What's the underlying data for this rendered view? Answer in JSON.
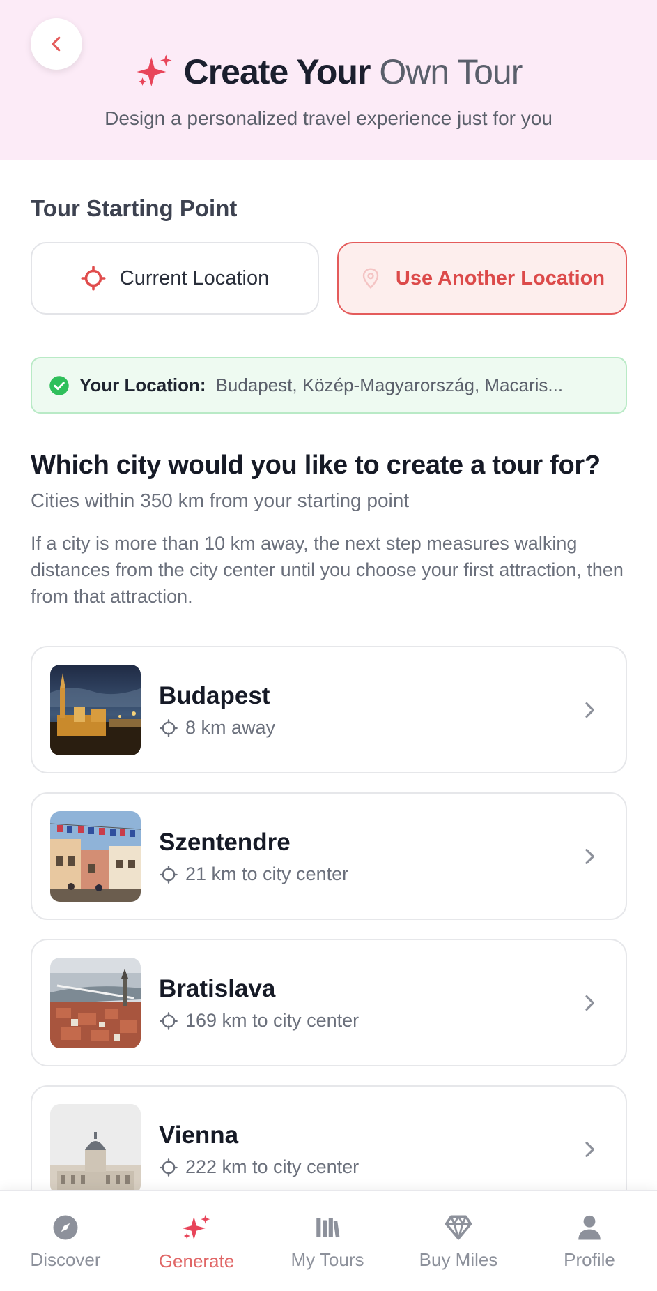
{
  "header": {
    "title_bold": "Create Your",
    "title_light": "Own Tour",
    "subtitle": "Design a personalized travel experience just for you",
    "back_icon": "chevron-left-icon",
    "title_icon": "sparkles-icon"
  },
  "starting_point": {
    "label": "Tour Starting Point",
    "current_label": "Current Location",
    "other_label": "Use Another Location",
    "selected": "other"
  },
  "your_location": {
    "label": "Your Location:",
    "value": "Budapest, Közép-Magyarország, Macaris..."
  },
  "city_section": {
    "question": "Which city would you like to create a tour for?",
    "range": "Cities within 350 km from your starting point",
    "note": "If a city is more than 10 km away, the next step measures walking distances from the city center until you choose your first attraction, then from that attraction."
  },
  "cities": [
    {
      "name": "Budapest",
      "distance": "8 km away"
    },
    {
      "name": "Szentendre",
      "distance": "21 km to city center"
    },
    {
      "name": "Bratislava",
      "distance": "169 km to city center"
    },
    {
      "name": "Vienna",
      "distance": "222 km to city center"
    }
  ],
  "nav": {
    "active": "Generate",
    "items": [
      {
        "label": "Discover",
        "icon": "compass-icon"
      },
      {
        "label": "Generate",
        "icon": "sparkles-icon"
      },
      {
        "label": "My Tours",
        "icon": "library-icon"
      },
      {
        "label": "Buy Miles",
        "icon": "diamond-icon"
      },
      {
        "label": "Profile",
        "icon": "user-icon"
      }
    ]
  },
  "colors": {
    "accent": "#e45b5b",
    "header_bg": "#fcebf7",
    "success": "#2fbf5b",
    "success_bg": "#eefaf1"
  }
}
